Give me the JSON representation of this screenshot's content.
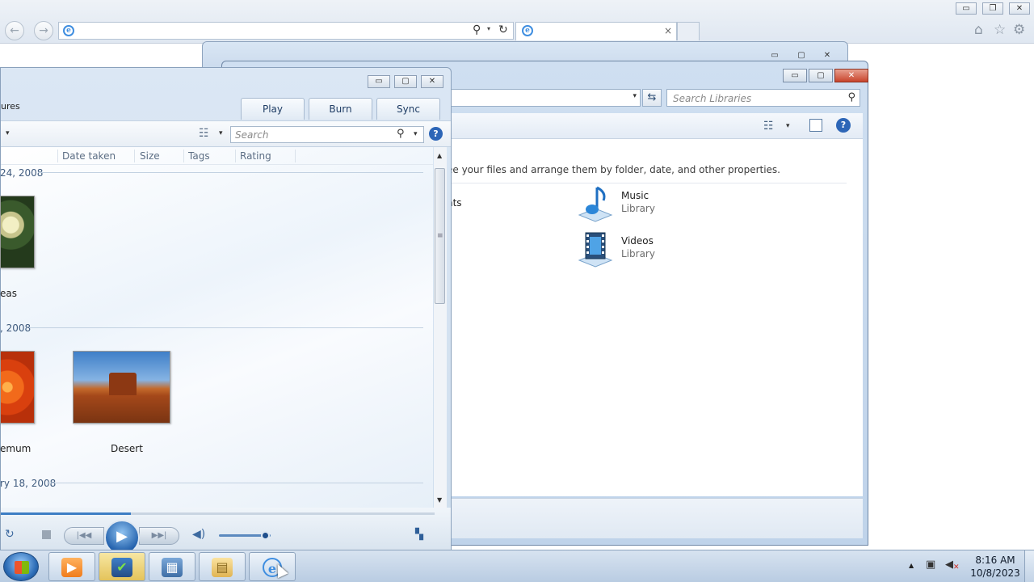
{
  "ie": {
    "back_icon": "back-arrow-icon",
    "forward_icon": "forward-arrow-icon",
    "address_value": "",
    "tab_title": "",
    "tab_close": "×",
    "logo_glyph": "e",
    "search_glyph": "⚲",
    "dropdown_glyph": "▾",
    "refresh_glyph": "↻",
    "min_glyph": "▭",
    "max_glyph": "❐",
    "close_glyph": "✕",
    "home_glyph": "⌂",
    "fav_glyph": "☆",
    "gear_glyph": "⚙"
  },
  "explorer_back": {
    "min_glyph": "▭",
    "max_glyph": "▢",
    "close_glyph": "✕"
  },
  "libraries": {
    "search_placeholder": "Search Libraries",
    "search_glyph": "⚲",
    "refresh_glyph": "⇆",
    "dropdown_glyph": "▾",
    "view_glyph": "☷",
    "help_glyph": "?",
    "description": "ee your files and arrange them by folder, date, and other properties.",
    "documents_partial": "nts",
    "min_glyph": "▭",
    "max_glyph": "▢",
    "close_glyph": "✕",
    "items": [
      {
        "name": "Music",
        "type": "Library",
        "icon": "music-library-icon"
      },
      {
        "name": "Videos",
        "type": "Library",
        "icon": "videos-library-icon"
      }
    ]
  },
  "wmp": {
    "breadcrumb": "ures",
    "tabs": {
      "play": "Play",
      "burn": "Burn",
      "sync": "Sync"
    },
    "search_placeholder": "Search",
    "search_glyph": "⚲",
    "dropdown_glyph": "▾",
    "help_glyph": "?",
    "view_glyph": "☷",
    "columns": {
      "date": "Date taken",
      "size": "Size",
      "tags": "Tags",
      "rating": "Rating"
    },
    "groups": [
      "24, 2008",
      ", 2008",
      "ry 18, 2008"
    ],
    "pictures": [
      {
        "label": "eas",
        "icon": "hydrangeas-thumbnail"
      },
      {
        "label": "emum",
        "icon": "chrysanthemum-thumbnail"
      },
      {
        "label": "Desert",
        "icon": "desert-thumbnail"
      }
    ],
    "scroll_up": "▲",
    "scroll_down": "▼",
    "scroll_grip": "≡",
    "min_glyph": "▭",
    "max_glyph": "▢",
    "close_glyph": "✕",
    "controls": {
      "repeat_glyph": "↻",
      "prev_glyph": "|◀◀",
      "play_glyph": "▶",
      "next_glyph": "▶▶|",
      "mute_glyph": "◀)",
      "switch_glyph": "▚"
    },
    "seek_fraction": 0.3,
    "volume_fraction": 0.9
  },
  "taskbar": {
    "start_icon": "windows-start-icon",
    "buttons": [
      {
        "name": "media-player",
        "glyph": "▶"
      },
      {
        "name": "task-scheduler",
        "glyph": "✔"
      },
      {
        "name": "control-panel",
        "glyph": "▦"
      },
      {
        "name": "windows-explorer",
        "glyph": "▤"
      },
      {
        "name": "internet-explorer",
        "glyph": "e"
      }
    ],
    "tray_up": "▲",
    "tray_net": "▣",
    "tray_vol": "◀",
    "tray_vol_x": "✕",
    "time": "8:16 AM",
    "date": "10/8/2023"
  }
}
